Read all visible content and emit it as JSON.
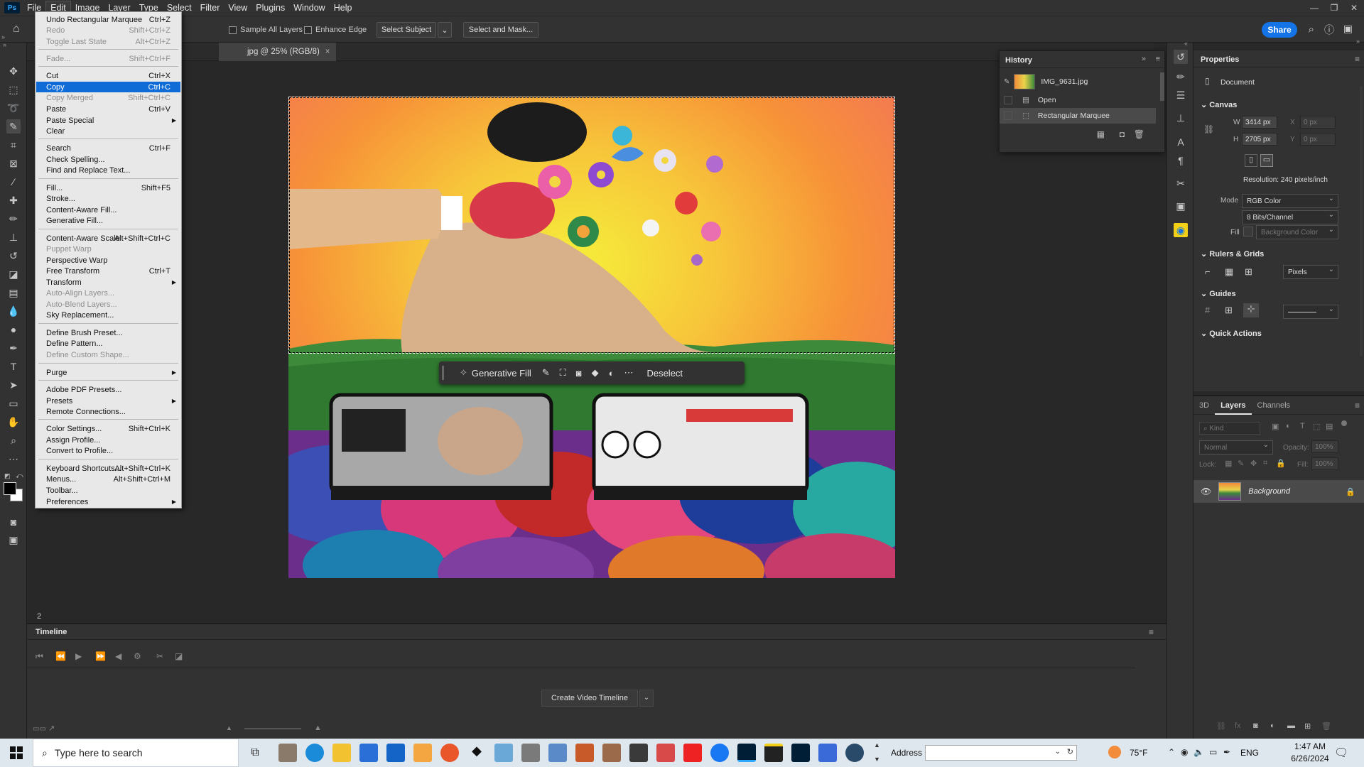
{
  "app": {
    "name": "Ps",
    "brand_color": "#31a8ff",
    "accent": "#1473e6"
  },
  "menubar": {
    "items": [
      "File",
      "Edit",
      "Image",
      "Layer",
      "Type",
      "Select",
      "Filter",
      "View",
      "Plugins",
      "Window",
      "Help"
    ],
    "active": "Edit"
  },
  "options": {
    "sample_all_layers": "Sample All Layers",
    "enhance_edge": "Enhance Edge",
    "select_subject": "Select Subject",
    "select_and_mask": "Select and Mask...",
    "share": "Share"
  },
  "document": {
    "tab_title": "jpg @ 25% (RGB/8)",
    "zoom_status": "2"
  },
  "edit_menu": {
    "items": [
      {
        "label": "Undo Rectangular Marquee",
        "shortcut": "Ctrl+Z",
        "disabled": false
      },
      {
        "label": "Redo",
        "shortcut": "Shift+Ctrl+Z",
        "disabled": true
      },
      {
        "label": "Toggle Last State",
        "shortcut": "Alt+Ctrl+Z",
        "disabled": true
      },
      {
        "label": "Fade...",
        "shortcut": "Shift+Ctrl+F",
        "disabled": true
      },
      {
        "label": "Cut",
        "shortcut": "Ctrl+X",
        "disabled": false
      },
      {
        "label": "Copy",
        "shortcut": "Ctrl+C",
        "disabled": false,
        "highlighted": true
      },
      {
        "label": "Copy Merged",
        "shortcut": "Shift+Ctrl+C",
        "disabled": true
      },
      {
        "label": "Paste",
        "shortcut": "Ctrl+V",
        "disabled": false
      },
      {
        "label": "Paste Special",
        "submenu": true
      },
      {
        "label": "Clear"
      },
      {
        "label": "Search",
        "shortcut": "Ctrl+F"
      },
      {
        "label": "Check Spelling..."
      },
      {
        "label": "Find and Replace Text..."
      },
      {
        "label": "Fill...",
        "shortcut": "Shift+F5"
      },
      {
        "label": "Stroke..."
      },
      {
        "label": "Content-Aware Fill..."
      },
      {
        "label": "Generative Fill..."
      },
      {
        "label": "Content-Aware Scale",
        "shortcut": "Alt+Shift+Ctrl+C"
      },
      {
        "label": "Puppet Warp",
        "disabled": true
      },
      {
        "label": "Perspective Warp"
      },
      {
        "label": "Free Transform",
        "shortcut": "Ctrl+T"
      },
      {
        "label": "Transform",
        "submenu": true
      },
      {
        "label": "Auto-Align Layers...",
        "disabled": true
      },
      {
        "label": "Auto-Blend Layers...",
        "disabled": true
      },
      {
        "label": "Sky Replacement..."
      },
      {
        "label": "Define Brush Preset..."
      },
      {
        "label": "Define Pattern..."
      },
      {
        "label": "Define Custom Shape...",
        "disabled": true
      },
      {
        "label": "Purge",
        "submenu": true
      },
      {
        "label": "Adobe PDF Presets..."
      },
      {
        "label": "Presets",
        "submenu": true
      },
      {
        "label": "Remote Connections..."
      },
      {
        "label": "Color Settings...",
        "shortcut": "Shift+Ctrl+K"
      },
      {
        "label": "Assign Profile..."
      },
      {
        "label": "Convert to Profile..."
      },
      {
        "label": "Keyboard Shortcuts...",
        "shortcut": "Alt+Shift+Ctrl+K"
      },
      {
        "label": "Menus...",
        "shortcut": "Alt+Shift+Ctrl+M"
      },
      {
        "label": "Toolbar..."
      },
      {
        "label": "Preferences",
        "submenu": true
      }
    ]
  },
  "contextual_bar": {
    "generative_fill": "Generative Fill",
    "deselect": "Deselect"
  },
  "history": {
    "title": "History",
    "snapshot": "IMG_9631.jpg",
    "states": [
      "Open",
      "Rectangular Marquee"
    ]
  },
  "properties": {
    "title": "Properties",
    "kind": "Document",
    "canvas": {
      "heading": "Canvas",
      "w_label": "W",
      "w_value": "3414 px",
      "h_label": "H",
      "h_value": "2705 px",
      "x_label": "X",
      "x_value": "0 px",
      "y_label": "Y",
      "y_value": "0 px",
      "resolution": "Resolution: 240 pixels/inch",
      "mode_label": "Mode",
      "mode_value": "RGB Color",
      "depth_value": "8 Bits/Channel",
      "fill_label": "Fill",
      "fill_value": "Background Color"
    },
    "rulers_grids": {
      "heading": "Rulers & Grids",
      "units": "Pixels"
    },
    "guides": {
      "heading": "Guides"
    },
    "quick_actions": {
      "heading": "Quick Actions"
    }
  },
  "layers": {
    "tabs": [
      "3D",
      "Layers",
      "Channels"
    ],
    "active_tab": "Layers",
    "kind_placeholder": "Kind",
    "blend_mode": "Normal",
    "opacity_label": "Opacity:",
    "opacity_value": "100%",
    "lock_label": "Lock:",
    "fill_label": "Fill:",
    "fill_value": "100%",
    "layer_name": "Background"
  },
  "timeline": {
    "title": "Timeline",
    "create_button": "Create Video Timeline"
  },
  "taskbar": {
    "search_placeholder": "Type here to search",
    "address_label": "Address",
    "temperature": "75°F",
    "language": "ENG",
    "time": "1:47 AM",
    "date": "6/26/2024"
  }
}
